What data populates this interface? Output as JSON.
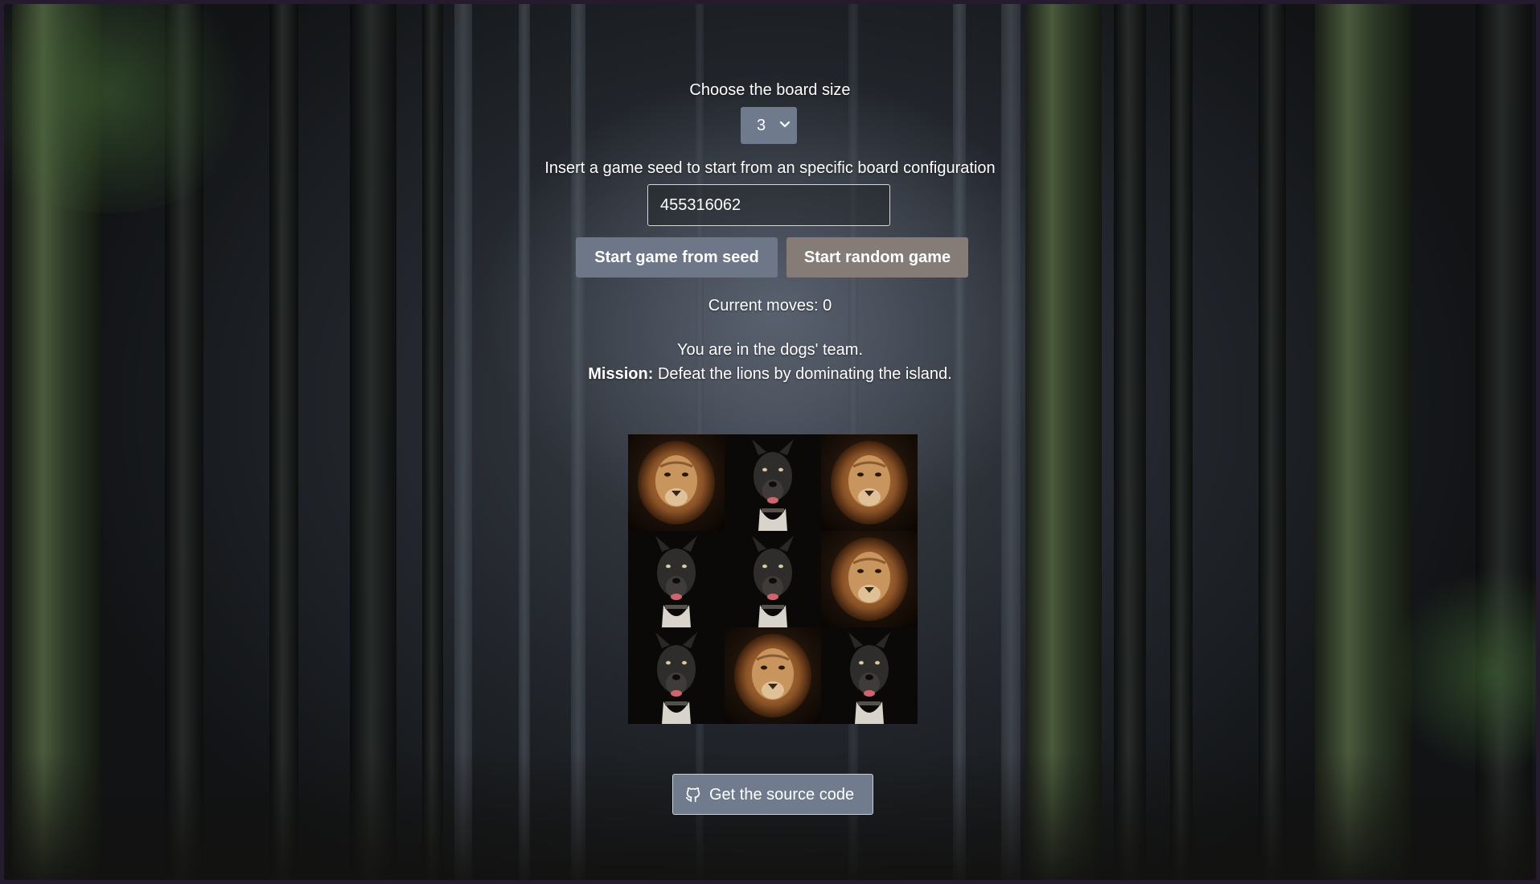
{
  "board_size": {
    "label": "Choose the board size",
    "selected": "3"
  },
  "seed": {
    "label": "Insert a game seed to start from an specific board configuration",
    "value": "455316062"
  },
  "buttons": {
    "start_from_seed": "Start game from seed",
    "start_random": "Start random game"
  },
  "moves": {
    "text": "Current moves: 0"
  },
  "team": {
    "text": "You are in the dogs' team.",
    "mission_label": "Mission:",
    "mission_text": " Defeat the lions by dominating the island."
  },
  "board": {
    "cells": [
      [
        "lion",
        "dog",
        "lion"
      ],
      [
        "dog",
        "dog",
        "lion"
      ],
      [
        "dog",
        "lion",
        "dog"
      ]
    ]
  },
  "source": {
    "label": "Get the source code",
    "icon": "github-icon"
  }
}
